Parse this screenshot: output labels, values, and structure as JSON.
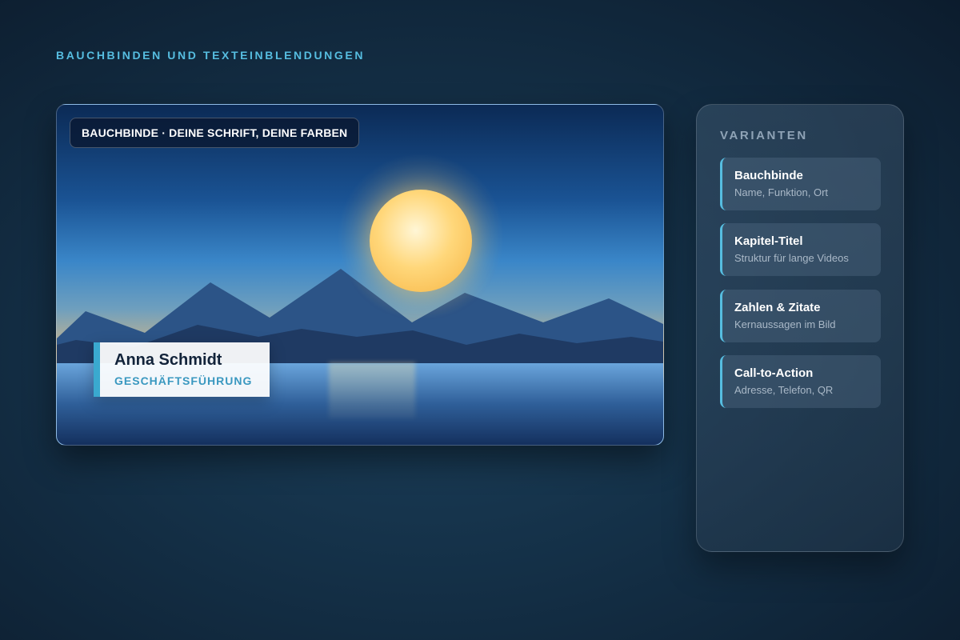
{
  "page": {
    "heading": "BAUCHBINDEN UND TEXTEINBLENDUNGEN"
  },
  "preview": {
    "badge": "BAUCHBINDE · DEINE SCHRIFT, DEINE FARBEN",
    "lower_third": {
      "name": "Anna Schmidt",
      "role": "GESCHÄFTSFÜHRUNG",
      "accent_color": "#3aa9cf"
    }
  },
  "panel": {
    "title": "VARIANTEN",
    "variants": [
      {
        "title": "Bauchbinde",
        "subtitle": "Name, Funktion, Ort"
      },
      {
        "title": "Kapitel-Titel",
        "subtitle": "Struktur für lange Videos"
      },
      {
        "title": "Zahlen & Zitate",
        "subtitle": "Kernaussagen im Bild"
      },
      {
        "title": "Call-to-Action",
        "subtitle": "Adresse, Telefon, QR"
      }
    ]
  },
  "colors": {
    "accent": "#56bde0",
    "background": "#143047"
  }
}
